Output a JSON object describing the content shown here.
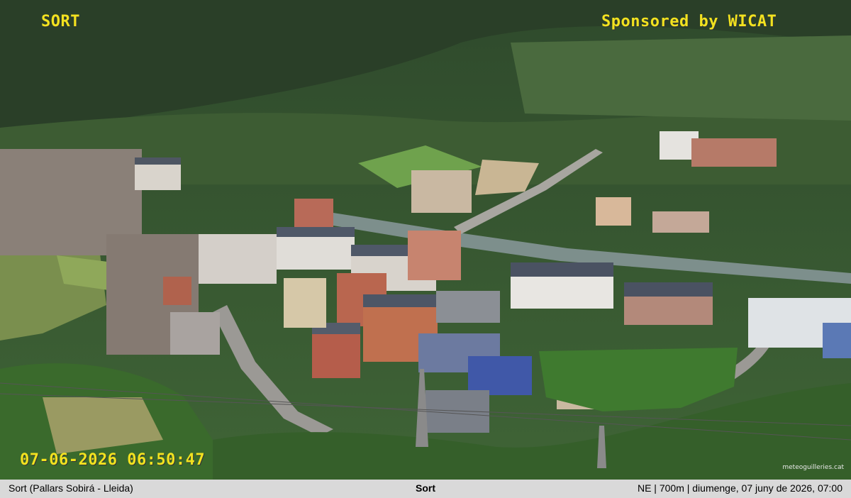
{
  "overlay": {
    "camera_name": "SORT",
    "sponsor": "Sponsored by WICAT",
    "timestamp": "07-06-2026 06:50:47",
    "watermark": "meteoguilleries.cat"
  },
  "info_bar": {
    "location": "Sort (Pallars Sobirá - Lleida)",
    "title": "Sort",
    "details": "NE | 700m | diumenge, 07 juny de 2026, 07:00"
  },
  "colors": {
    "overlay_text": "#f2e21f",
    "info_bar_bg": "#d9d9d9"
  }
}
